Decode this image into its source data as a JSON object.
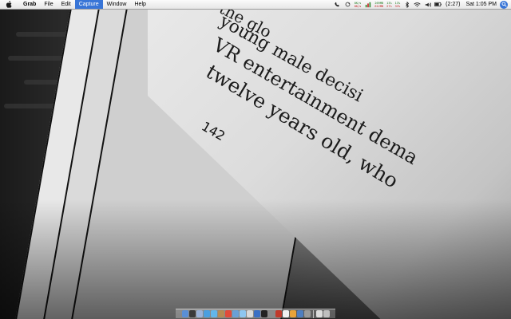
{
  "menubar": {
    "app_name": "Grab",
    "menus": [
      "File",
      "Edit",
      "Capture",
      "Window",
      "Help"
    ],
    "active_menu": "Capture",
    "status": {
      "stat1_a": "0K/s",
      "stat1_b": "0K/s",
      "stat2_a": "269MB",
      "stat2_b": "612MB",
      "stat3_a": "13%",
      "stat3_b": "27%",
      "stat4_a": "13%",
      "stat4_b": "33%",
      "battery_time": "(2:27)",
      "clock": "Sat 1:05 PM"
    }
  },
  "wallpaper": {
    "book_lines": [
      "the glo",
      "young male decisi",
      "VR entertainment dema",
      "twelve years old, who"
    ],
    "page_number": "142"
  },
  "dock": {
    "icons": [
      {
        "name": "finder-icon",
        "color": "#5a8fd6"
      },
      {
        "name": "dashboard-icon",
        "color": "#3a3a3a"
      },
      {
        "name": "mail-icon",
        "color": "#9ab2d8"
      },
      {
        "name": "safari-icon",
        "color": "#4a9fe0"
      },
      {
        "name": "ichat-icon",
        "color": "#62b6ea"
      },
      {
        "name": "address-book-icon",
        "color": "#b58a52"
      },
      {
        "name": "ical-icon",
        "color": "#e24a3a"
      },
      {
        "name": "iphoto-icon",
        "color": "#6aa0d6"
      },
      {
        "name": "itunes-icon",
        "color": "#8ec6f0"
      },
      {
        "name": "preview-icon",
        "color": "#d8d8d8"
      },
      {
        "name": "quicktime-icon",
        "color": "#3b6fc4"
      },
      {
        "name": "terminal-icon",
        "color": "#222222"
      },
      {
        "name": "system-preferences-icon",
        "color": "#8a8a8a"
      },
      {
        "name": "app-icon-1",
        "color": "#c0392b"
      },
      {
        "name": "app-icon-2",
        "color": "#f0f0f0"
      },
      {
        "name": "app-icon-3",
        "color": "#e8a33a"
      },
      {
        "name": "app-icon-4",
        "color": "#4f7ec0"
      },
      {
        "name": "app-icon-5",
        "color": "#9a9a9a"
      }
    ],
    "trailing_icons": [
      {
        "name": "downloads-stack-icon",
        "color": "#dcdcdc"
      },
      {
        "name": "trash-icon",
        "color": "#bfbfbf"
      }
    ]
  }
}
